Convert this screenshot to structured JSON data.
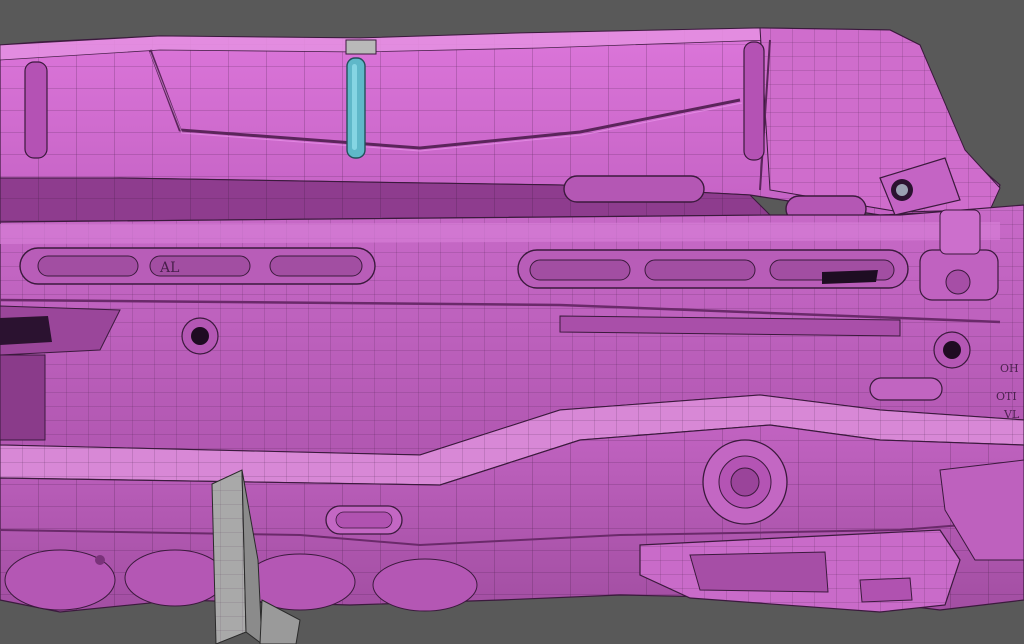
{
  "scene": {
    "background": "#595959",
    "model_colors": {
      "top": "#d26ad0",
      "mid": "#c05ec0",
      "dark": "#8e3c8e",
      "deep": "#6a2a6a",
      "highlight": "#e58ae2",
      "wire": "#3b1a3d",
      "accent_cyan": "#5fb8c9",
      "grey_part": "#a9a9a9"
    },
    "wireframe": true
  },
  "engraved_text": {
    "line1": "OH",
    "line2": "OTI",
    "line3": "VL",
    "partial_glyphs": "AL"
  }
}
